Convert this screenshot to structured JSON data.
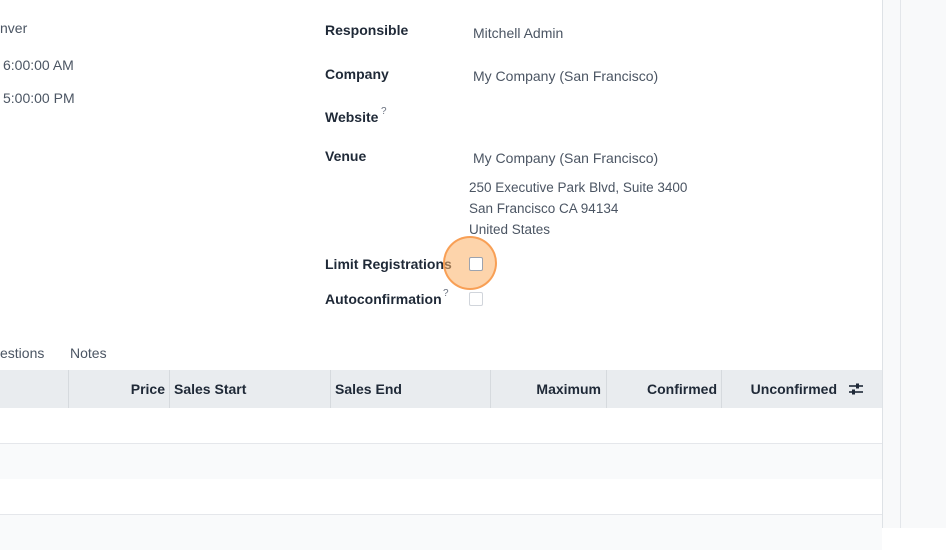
{
  "left_fields": {
    "timezone_partial": "nver",
    "start_time_partial": "6:00:00 AM",
    "end_time_partial": "5:00:00 PM"
  },
  "form": {
    "responsible_label": "Responsible",
    "responsible_value": "Mitchell Admin",
    "company_label": "Company",
    "company_value": "My Company (San Francisco)",
    "website_label": "Website",
    "website_help": "?",
    "venue_label": "Venue",
    "venue_value": "My Company (San Francisco)",
    "venue_address_line1": "250 Executive Park Blvd, Suite 3400",
    "venue_address_line2": "San Francisco CA 94134",
    "venue_address_line3": "United States",
    "limit_registrations_label": "Limit Registrations",
    "limit_registrations_checked": false,
    "autoconfirmation_label": "Autoconfirmation",
    "autoconfirmation_help": "?",
    "autoconfirmation_checked": false
  },
  "tabs": {
    "questions_partial": "estions",
    "notes": "Notes"
  },
  "table": {
    "columns": {
      "price": "Price",
      "sales_start": "Sales Start",
      "sales_end": "Sales End",
      "maximum": "Maximum",
      "confirmed": "Confirmed",
      "unconfirmed": "Unconfirmed"
    },
    "settings_icon": "sliders-icon"
  },
  "colors": {
    "highlight": "#fbb066",
    "header_bg": "#e9ecef"
  }
}
